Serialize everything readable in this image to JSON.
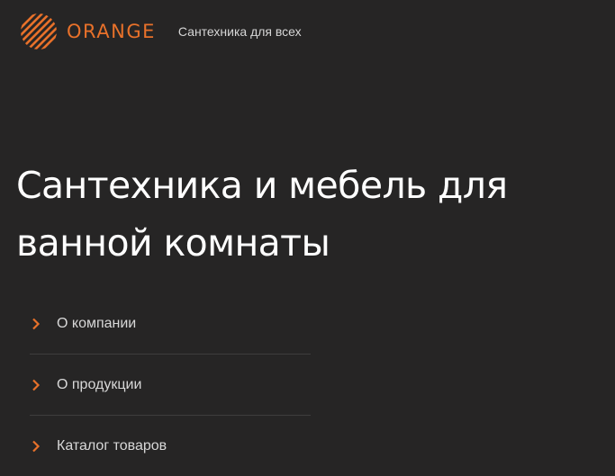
{
  "header": {
    "logo_text": "ORANGE",
    "tagline": "Сантехника для всех"
  },
  "hero": {
    "title_line1": "Сантехника и мебель для",
    "title_line2": "ванной комнаты"
  },
  "menu": {
    "items": [
      {
        "label": "О компании",
        "icon": "chevron-right-icon"
      },
      {
        "label": "О продукции",
        "icon": "chevron-right-icon"
      },
      {
        "label": "Каталог товаров",
        "icon": "chevron-right-icon"
      }
    ]
  },
  "colors": {
    "background": "#262525",
    "accent": "#e8712a",
    "text": "#ffffff",
    "divider": "#3e3d3d"
  }
}
